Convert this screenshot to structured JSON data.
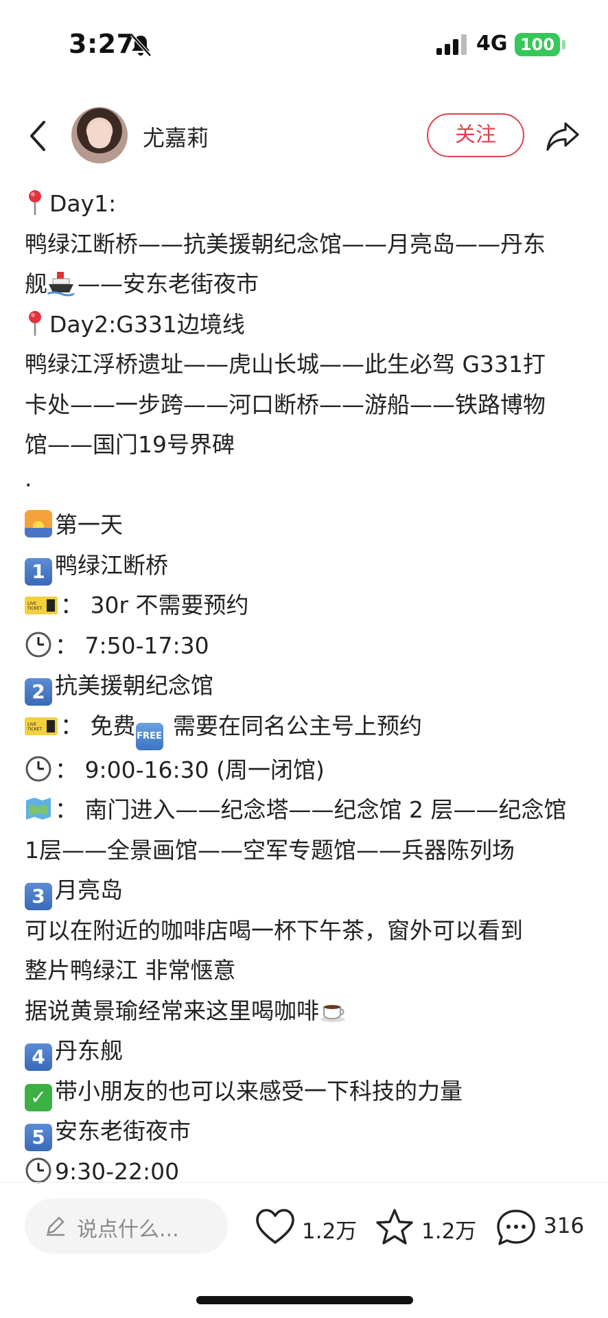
{
  "status_bar": {
    "time": "3:27",
    "network": "4G",
    "battery": "100"
  },
  "header": {
    "username": "尤嘉莉",
    "follow_label": "关注"
  },
  "content": {
    "lines": [
      {
        "icon": "pin",
        "text": "Day1:"
      },
      {
        "icon": "",
        "text": "鸭绿江断桥——抗美援朝纪念馆——月亮岛——丹东"
      },
      {
        "icon": "",
        "text": "舰",
        "icon_after": "ship",
        "text2": "——安东老街夜市"
      },
      {
        "icon": "pin",
        "text": "Day2:G331边境线"
      },
      {
        "icon": "",
        "text": "鸭绿江浮桥遗址——虎山长城——此生必驾 G331打"
      },
      {
        "icon": "",
        "text": "卡处——一步跨——河口断桥——游船——铁路博物"
      },
      {
        "icon": "",
        "text": "馆——国门19号界碑"
      },
      {
        "icon": "",
        "text": "·"
      },
      {
        "icon": "sunrise",
        "text": "第一天"
      },
      {
        "icon": "1",
        "text": "鸭绿江断桥"
      },
      {
        "icon": "ticket",
        "text": "：  30r 不需要预约"
      },
      {
        "icon": "clock",
        "text": "：  7:50-17:30"
      },
      {
        "icon": "2",
        "text": "抗美援朝纪念馆"
      },
      {
        "icon": "ticket",
        "text": "：  免费",
        "icon_after": "free",
        "text2": " 需要在同名公主号上预约"
      },
      {
        "icon": "clock",
        "text": "：  9:00-16:30 (周一闭馆)"
      },
      {
        "icon": "map",
        "text": "：  南门进入——纪念塔——纪念馆 2 层——纪念馆"
      },
      {
        "icon": "",
        "text": "1层——全景画馆——空军专题馆——兵器陈列场"
      },
      {
        "icon": "3",
        "text": "月亮岛"
      },
      {
        "icon": "",
        "text": "可以在附近的咖啡店喝一杯下午茶，窗外可以看到"
      },
      {
        "icon": "",
        "text": "整片鸭绿江 非常惬意"
      },
      {
        "icon": "",
        "text": "据说黄景瑜经常来这里喝咖啡",
        "icon_after": "coffee",
        "text2": ""
      },
      {
        "icon": "4",
        "text": "丹东舰"
      },
      {
        "icon": "check",
        "text": "带小朋友的也可以来感受一下科技的力量"
      },
      {
        "icon": "5",
        "text": "安东老街夜市"
      },
      {
        "icon": "clock",
        "text": "9:30-22:00"
      }
    ]
  },
  "bottom_bar": {
    "comment_placeholder": "说点什么...",
    "likes": "1.2万",
    "favorites": "1.2万",
    "comments": "316"
  },
  "colors": {
    "accent": "#e0404d",
    "battery": "#35c759"
  }
}
